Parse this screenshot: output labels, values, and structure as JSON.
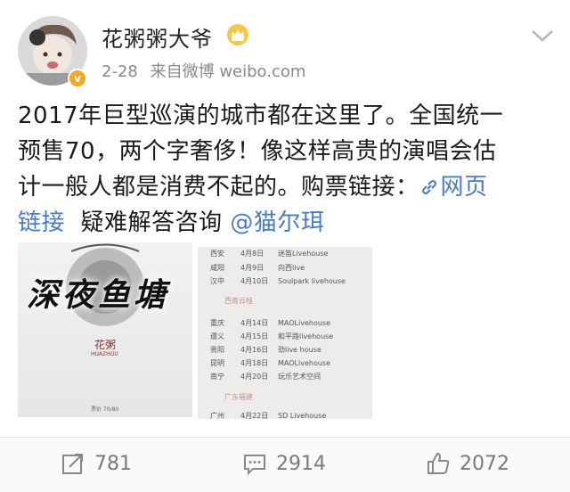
{
  "post": {
    "username": "花粥粥大爷",
    "date": "2-28",
    "source": "来自微博 weibo.com",
    "text_lines": [
      "2017年巨型巡演的城市都在这里了。全国统一",
      "预售70，两个字奢侈！像这样高贵的演唱会估",
      "计一般人都是消费不起的。购票链接："
    ],
    "link_label": "网页",
    "link_label_2": "链接",
    "faq": "疑难解答咨询",
    "mention": "@猫尔珥",
    "watermark": "深夜鱼塘"
  },
  "images": {
    "poster_title": "花粥",
    "poster_subtitle": "HUAZHOU",
    "poster_price": "票价 70/80",
    "schedule": [
      {
        "city": "西安",
        "date": "4月8日",
        "venue": "迷笛Livehouse"
      },
      {
        "city": "咸阳",
        "date": "4月9日",
        "venue": "向西live"
      },
      {
        "city": "汉中",
        "date": "4月10日",
        "venue": "Soulpark livehouse"
      }
    ],
    "section_southwest": "西南云桂",
    "schedule2": [
      {
        "city": "重庆",
        "date": "4月14日",
        "venue": "MAOLivehouse"
      },
      {
        "city": "遵义",
        "date": "4月15日",
        "venue": "和平路livehouse"
      },
      {
        "city": "贵阳",
        "date": "4月16日",
        "venue": "劲live house"
      },
      {
        "city": "昆明",
        "date": "4月18日",
        "venue": "MAOLivehouse"
      },
      {
        "city": "南宁",
        "date": "4月20日",
        "venue": "玩乐艺术空间"
      }
    ],
    "section_guangdong": "广东福建",
    "schedule3_partial": {
      "city": "广州",
      "date": "4月22日",
      "venue": "SD Livehouse"
    }
  },
  "actions": {
    "repost_count": "781",
    "comment_count": "2914",
    "like_count": "2072"
  },
  "colors": {
    "link": "#4a7cc1",
    "vip_gold": "#f5a623"
  },
  "icons": [
    "repost-icon",
    "comment-icon",
    "like-icon",
    "link-icon",
    "chevron-down-icon",
    "vip-crown-icon",
    "verified-icon"
  ]
}
